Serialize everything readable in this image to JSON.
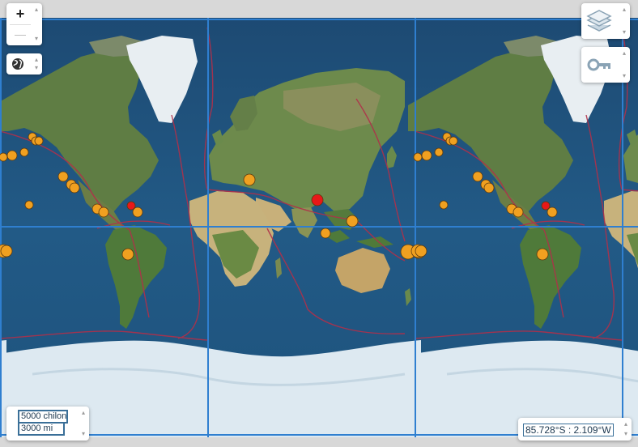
{
  "controls": {
    "zoom_in": "+",
    "zoom_out": "—",
    "spin_up": "▴",
    "spin_down": "▾"
  },
  "scale": {
    "metric": "5000 chilon",
    "imperial": "3000 mi"
  },
  "coordinates": "85.728°S : 2.109°W",
  "colors": {
    "ocean": "#1d4f7a",
    "land": "#6b8a4a",
    "ice": "#dfeaf2",
    "graticule": "#2f7fd0",
    "plate_boundary": "#b0304a",
    "quake_moderate": "#f0a020",
    "quake_strong": "#e81818"
  },
  "icons": {
    "locate": "globe-icon",
    "layers": "layers-icon",
    "legend": "key-icon"
  }
}
